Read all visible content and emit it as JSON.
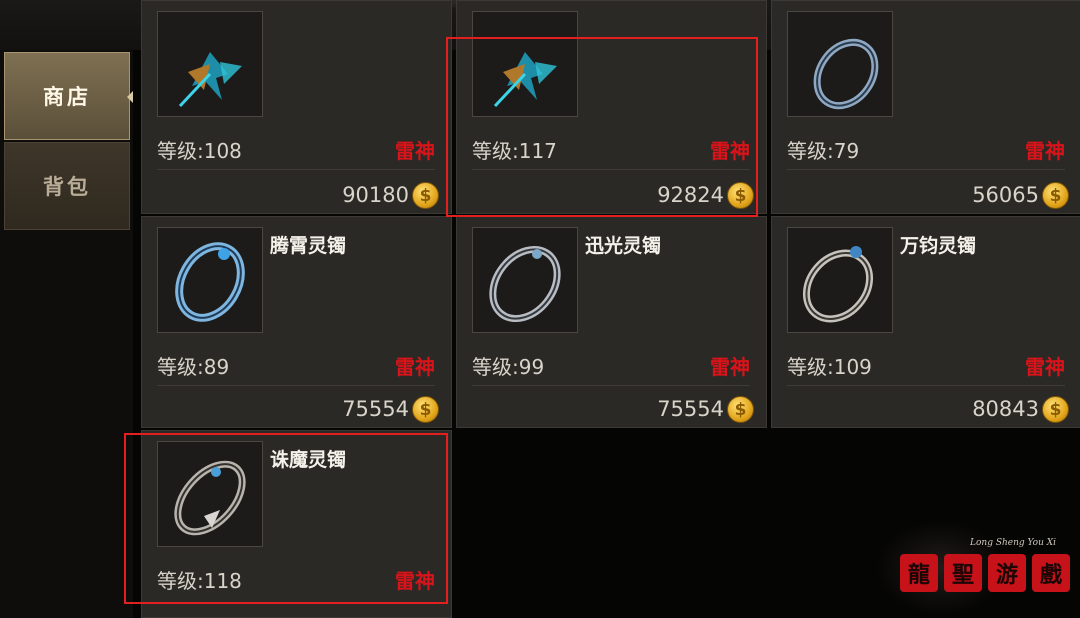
{
  "sidebar": {
    "tabs": [
      {
        "label": "商店",
        "active": true
      },
      {
        "label": "背包",
        "active": false
      }
    ]
  },
  "items": [
    {
      "name": "",
      "level": "等级:108",
      "class_tag": "雷神",
      "price": "90180",
      "icon": "thunder-crystal-icon"
    },
    {
      "name": "",
      "level": "等级:117",
      "class_tag": "雷神",
      "price": "92824",
      "icon": "thunder-crystal-icon"
    },
    {
      "name": "",
      "level": "等级:79",
      "class_tag": "雷神",
      "price": "56065",
      "icon": "bracelet-icon"
    },
    {
      "name": "腾霄灵镯",
      "level": "等级:89",
      "class_tag": "雷神",
      "price": "75554",
      "icon": "bracelet-icon"
    },
    {
      "name": "迅光灵镯",
      "level": "等级:99",
      "class_tag": "雷神",
      "price": "75554",
      "icon": "bracelet-icon"
    },
    {
      "name": "万钧灵镯",
      "level": "等级:109",
      "class_tag": "雷神",
      "price": "80843",
      "icon": "bracelet-icon"
    },
    {
      "name": "诛魔灵镯",
      "level": "等级:118",
      "class_tag": "雷神",
      "price": "",
      "icon": "bracelet-icon"
    }
  ],
  "currency": {
    "icon": "gold-coin-icon",
    "glyph": "$"
  },
  "watermark": {
    "subtitle": "Long Sheng You Xi",
    "seal_chars": [
      "龍",
      "聖",
      "游",
      "戲"
    ]
  },
  "colors": {
    "class_tag": "#d8141a",
    "highlight": "#e3201f",
    "card_bg": "#2b2926",
    "active_tab": "#6e6148",
    "coin": "#e2a51a"
  }
}
